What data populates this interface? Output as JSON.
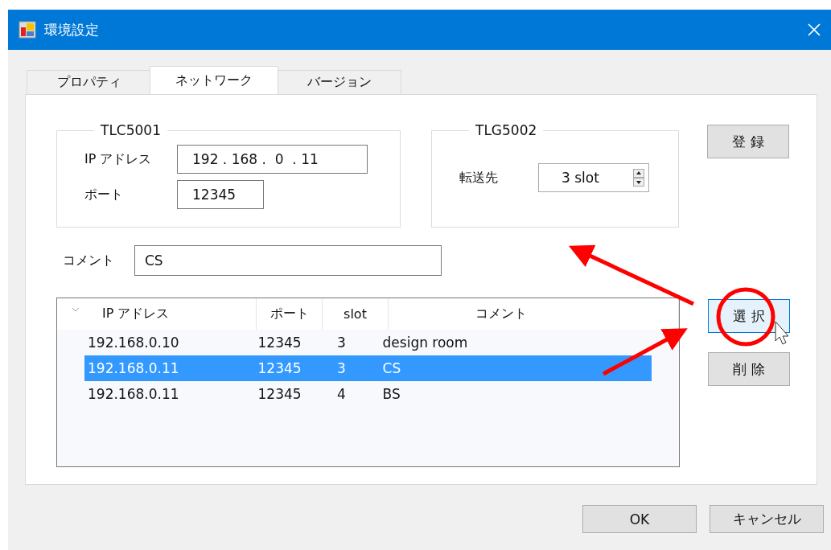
{
  "window": {
    "title": "環境設定"
  },
  "tabs": [
    {
      "label": "プロパティ",
      "selected": false
    },
    {
      "label": "ネットワーク",
      "selected": true
    },
    {
      "label": "バージョン",
      "selected": false
    }
  ],
  "groups": [
    {
      "title": "TLC5001",
      "fields": [
        {
          "kind": "text",
          "label": "IP アドレス",
          "value": "192 . 168 .  0  . 11"
        },
        {
          "kind": "text",
          "label": "ポート",
          "value": "12345"
        }
      ]
    },
    {
      "title": "TLG5002",
      "fields": [
        {
          "kind": "spinner",
          "label": "転送先",
          "value": "3 slot"
        }
      ]
    }
  ],
  "register_button": "登 録",
  "comment": {
    "label": "コメント",
    "value": "CS"
  },
  "list": {
    "columns": [
      "IP アドレス",
      "ポート",
      "slot",
      "コメント"
    ],
    "rows": [
      {
        "cells": [
          "192.168.0.10",
          "12345",
          "3",
          "design room"
        ],
        "selected": false
      },
      {
        "cells": [
          "192.168.0.11",
          "12345",
          "3",
          "CS"
        ],
        "selected": true
      },
      {
        "cells": [
          "192.168.0.11",
          "12345",
          "4",
          "BS"
        ],
        "selected": false
      }
    ]
  },
  "side_buttons": [
    {
      "label": "選 択",
      "hovered": true
    },
    {
      "label": "削 除",
      "hovered": false
    }
  ],
  "footer_buttons": [
    "OK",
    "キャンセル"
  ]
}
